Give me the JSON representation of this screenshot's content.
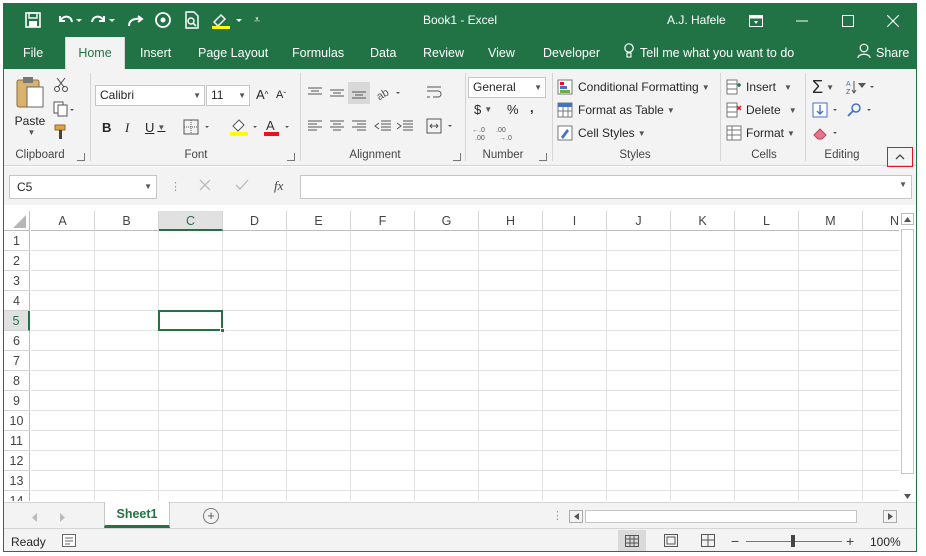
{
  "window": {
    "title": "Book1  -  Excel",
    "user": "A.J. Hafele"
  },
  "quick_access": [
    "save-icon",
    "undo-icon",
    "redo-icon",
    "touch-mode-icon",
    "print-preview-icon",
    "highlight-icon",
    "customize-icon"
  ],
  "tabs": [
    {
      "label": "File"
    },
    {
      "label": "Home"
    },
    {
      "label": "Insert"
    },
    {
      "label": "Page Layout"
    },
    {
      "label": "Formulas"
    },
    {
      "label": "Data"
    },
    {
      "label": "Review"
    },
    {
      "label": "View"
    },
    {
      "label": "Developer"
    }
  ],
  "tell_me": "Tell me what you want to do",
  "share": "Share",
  "ribbon": {
    "clipboard": {
      "label": "Clipboard",
      "paste": "Paste"
    },
    "font": {
      "label": "Font",
      "name": "Calibri",
      "size": "11",
      "bold": "B",
      "italic": "I",
      "underline": "U"
    },
    "alignment": {
      "label": "Alignment"
    },
    "number": {
      "label": "Number",
      "format": "General",
      "currency": "$",
      "percent": "%",
      "comma": ","
    },
    "styles": {
      "label": "Styles",
      "conditional": "Conditional Formatting",
      "format_table": "Format as Table",
      "cell_styles": "Cell Styles"
    },
    "cells": {
      "label": "Cells",
      "insert": "Insert",
      "delete": "Delete",
      "format": "Format"
    },
    "editing": {
      "label": "Editing",
      "sum": "Σ"
    }
  },
  "formula_bar": {
    "name_box": "C5",
    "fx": "fx",
    "value": ""
  },
  "grid": {
    "columns": [
      "A",
      "B",
      "C",
      "D",
      "E",
      "F",
      "G",
      "H",
      "I",
      "J",
      "K",
      "L",
      "M",
      "N"
    ],
    "rows": [
      "1",
      "2",
      "3",
      "4",
      "5",
      "6",
      "7",
      "8",
      "9",
      "10",
      "11",
      "12",
      "13",
      "14"
    ],
    "active_cell": "C5"
  },
  "sheets": [
    {
      "label": "Sheet1"
    }
  ],
  "status": {
    "ready": "Ready",
    "zoom": "100%"
  },
  "colors": {
    "accent": "#217346",
    "collapse_highlight": "#e81123"
  }
}
